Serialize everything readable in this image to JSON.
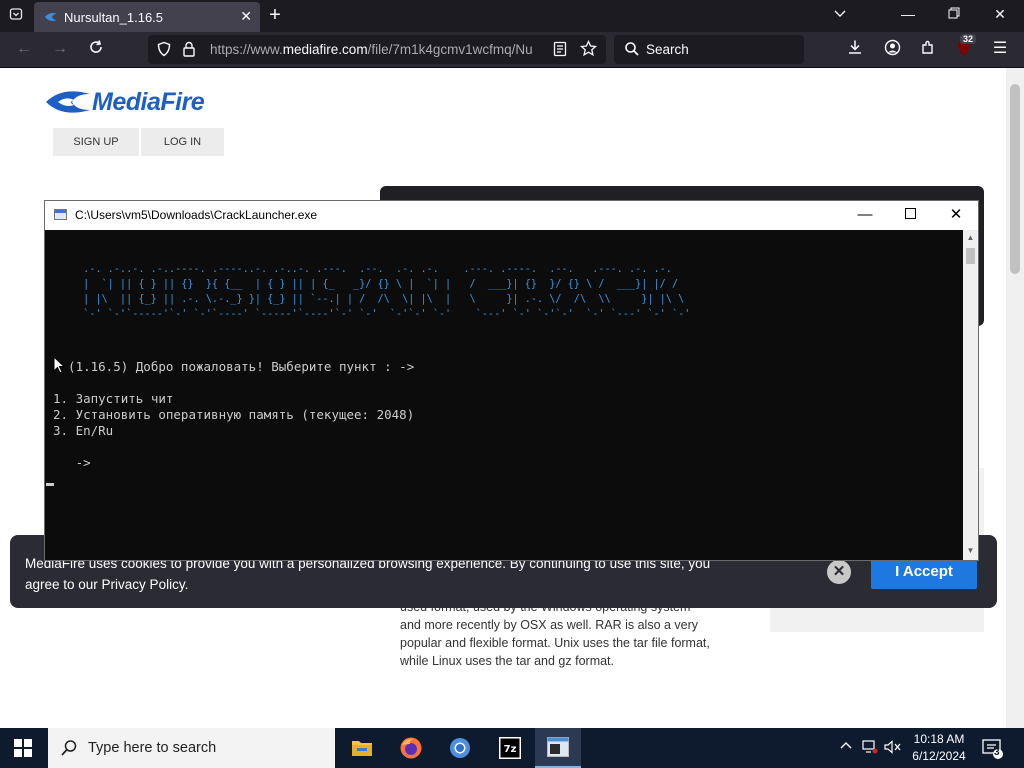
{
  "browser": {
    "tab_title": "Nursultan_1.16.5",
    "url_prefix": "https://www.",
    "url_domain": "mediafire.com",
    "url_rest": "/file/7m1k4gcmv1wcfmq/Nu",
    "search_placeholder": "Search",
    "extension_badge": "32"
  },
  "page": {
    "logo": "MediaFire",
    "sign_up": "SIGN UP",
    "log_in": "LOG IN",
    "body_lines": [
      "used format, used by the Windows operating system",
      "and more recently by OSX as well. RAR is also a very",
      "popular and flexible format. Unix uses the tar file format,",
      "while Linux uses the tar and gz format."
    ]
  },
  "cookie": {
    "text": "MediaFire uses cookies to provide you with a personalized browsing experience. By continuing to use this site, you agree to our Privacy Policy.",
    "accept": "I Accept"
  },
  "console": {
    "title": "C:\\Users\\vm5\\Downloads\\CrackLauncher.exe",
    "banner": [
      " .-. .-..-. .-..----. .----..-. .-..-. .---.  .--.  .-. .-.    .---. .----.  .--.   .---. .-. .-.",
      " |  `| || { } || {}  }{ {__  | { } || | {_   _}/ {} \\ |  `| |   /  ___}| {}  }/ {} \\ /  ___}| |/ /",
      " | |\\  || {_} || .-. \\.-._} }| {_} || `--.| | /  /\\  \\| |\\  |   \\     }| .-. \\/  /\\  \\\\     }| |\\ \\",
      " `-' `-'`-----'`-' `-'`----' `-----'`----'`-' `-'  `-'`-' `-'    `---' `-' `-'`-'  `-' `---' `-' `-'"
    ],
    "welcome": "  (1.16.5) Добро пожаловать! Выберите пункт : ->",
    "menu": [
      "1. Запустить чит",
      "2. Установить оперативную память (текущее: 2048)",
      "3. En/Ru"
    ],
    "prompt": "   ->"
  },
  "taskbar": {
    "search_placeholder": "Type here to search",
    "time": "10:18 AM",
    "date": "6/12/2024",
    "notifications": "3"
  }
}
